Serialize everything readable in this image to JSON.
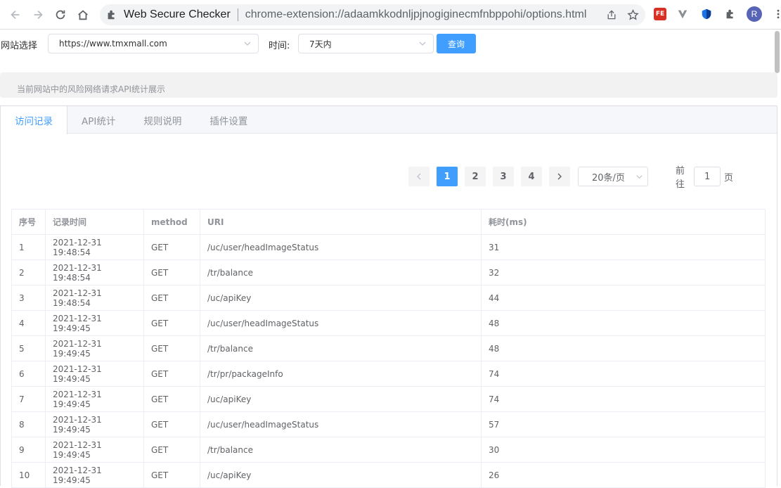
{
  "browser": {
    "tab_title": "Web Secure Checker",
    "url": "chrome-extension://adaamkkodnljpjnogiginecmfnbppohi/options.html",
    "profile_initial": "R",
    "ext_fe_label": "FE"
  },
  "filter": {
    "site_label": "网站选择",
    "site_value": "https://www.tmxmall.com",
    "time_label": "时间:",
    "time_value": "7天内",
    "query_button": "查询"
  },
  "info": {
    "text": "当前网站中的风险网络请求API统计展示"
  },
  "tabs": [
    {
      "label": "访问记录",
      "active": true
    },
    {
      "label": "API统计",
      "active": false
    },
    {
      "label": "规则说明",
      "active": false
    },
    {
      "label": "插件设置",
      "active": false
    }
  ],
  "pagination": {
    "pages": [
      "1",
      "2",
      "3",
      "4"
    ],
    "current": "1",
    "page_size": "20条/页",
    "goto_prefix": "前往",
    "goto_value": "1",
    "goto_suffix": "页"
  },
  "table": {
    "headers": [
      "序号",
      "记录时间",
      "method",
      "URI",
      "耗时(ms)"
    ],
    "rows": [
      [
        "1",
        "2021-12-31 19:48:54",
        "GET",
        "/uc/user/headImageStatus",
        "31"
      ],
      [
        "2",
        "2021-12-31 19:48:54",
        "GET",
        "/tr/balance",
        "32"
      ],
      [
        "3",
        "2021-12-31 19:48:54",
        "GET",
        "/uc/apiKey",
        "44"
      ],
      [
        "4",
        "2021-12-31 19:49:45",
        "GET",
        "/uc/user/headImageStatus",
        "48"
      ],
      [
        "5",
        "2021-12-31 19:49:45",
        "GET",
        "/tr/balance",
        "48"
      ],
      [
        "6",
        "2021-12-31 19:49:45",
        "GET",
        "/tr/pr/packageInfo",
        "74"
      ],
      [
        "7",
        "2021-12-31 19:49:45",
        "GET",
        "/uc/apiKey",
        "74"
      ],
      [
        "8",
        "2021-12-31 19:49:45",
        "GET",
        "/uc/user/headImageStatus",
        "57"
      ],
      [
        "9",
        "2021-12-31 19:49:45",
        "GET",
        "/tr/balance",
        "30"
      ],
      [
        "10",
        "2021-12-31 19:49:45",
        "GET",
        "/uc/apiKey",
        "26"
      ]
    ]
  },
  "colors": {
    "primary": "#409eff",
    "border": "#ebeef5",
    "text": "#606266"
  }
}
